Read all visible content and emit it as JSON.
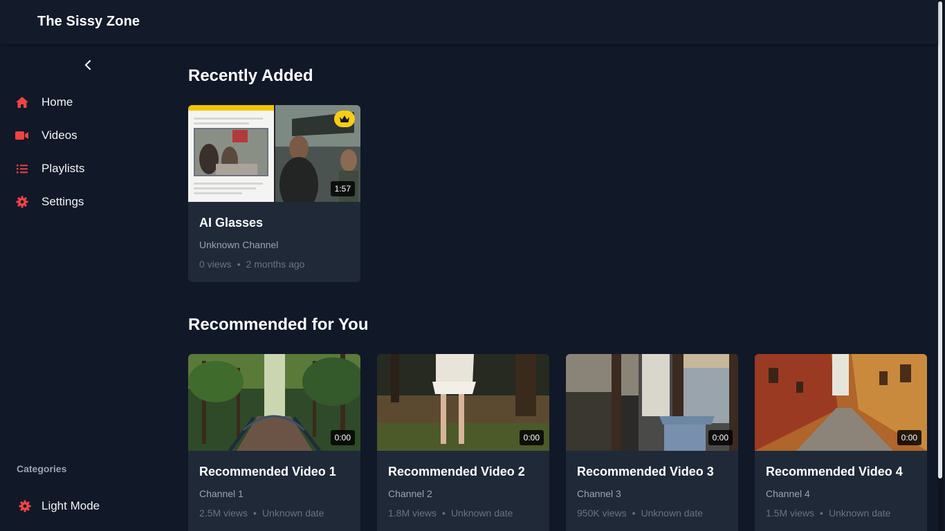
{
  "brand": {
    "title": "The Sissy Zone"
  },
  "sidebar": {
    "items": [
      {
        "label": "Home",
        "icon": "home-icon"
      },
      {
        "label": "Videos",
        "icon": "video-camera-icon"
      },
      {
        "label": "Playlists",
        "icon": "list-icon"
      },
      {
        "label": "Settings",
        "icon": "gear-icon"
      }
    ],
    "categories_heading": "Categories",
    "light_mode_label": "Light Mode"
  },
  "theme": {
    "accent": "#ef4444",
    "background": "#111827",
    "card": "#1f2937",
    "premium": "#facc15"
  },
  "recently_added": {
    "title": "Recently Added",
    "videos": [
      {
        "title": "AI Glasses",
        "channel": "Unknown Channel",
        "views": "0 views",
        "date": "2 months ago",
        "duration": "1:57",
        "premium": true
      }
    ]
  },
  "recommended": {
    "title": "Recommended for You",
    "videos": [
      {
        "title": "Recommended Video 1",
        "channel": "Channel 1",
        "views": "2.5M views",
        "date": "Unknown date",
        "duration": "0:00"
      },
      {
        "title": "Recommended Video 2",
        "channel": "Channel 2",
        "views": "1.8M views",
        "date": "Unknown date",
        "duration": "0:00"
      },
      {
        "title": "Recommended Video 3",
        "channel": "Channel 3",
        "views": "950K views",
        "date": "Unknown date",
        "duration": "0:00"
      },
      {
        "title": "Recommended Video 4",
        "channel": "Channel 4",
        "views": "1.5M views",
        "date": "Unknown date",
        "duration": "0:00"
      }
    ]
  },
  "meta_separator": "•"
}
